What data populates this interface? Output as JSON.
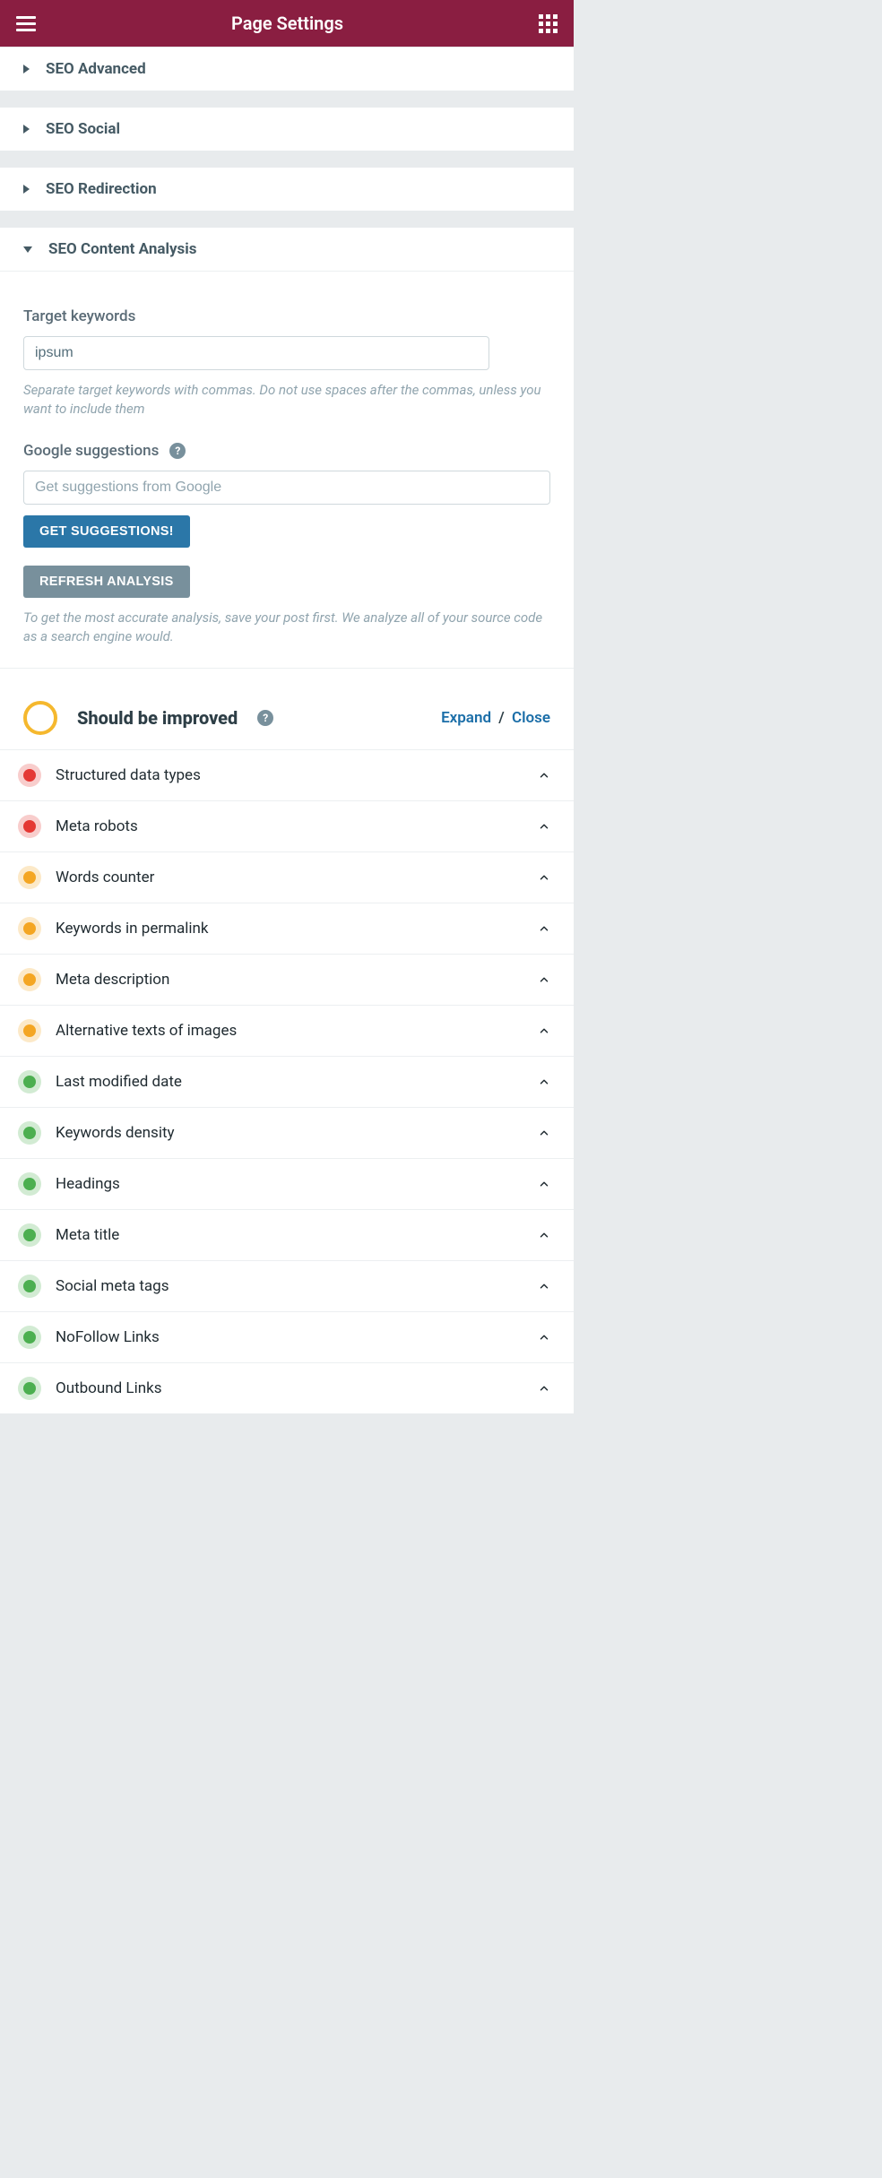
{
  "header": {
    "title": "Page Settings"
  },
  "sections": {
    "seo_advanced": "SEO Advanced",
    "seo_social": "SEO Social",
    "seo_redirection": "SEO Redirection",
    "seo_content_analysis": "SEO Content Analysis"
  },
  "target_keywords": {
    "label": "Target keywords",
    "value": "ipsum",
    "hint": "Separate target keywords with commas. Do not use spaces after the commas, unless you want to include them"
  },
  "google_suggestions": {
    "label": "Google suggestions",
    "placeholder": "Get suggestions from Google",
    "button": "GET SUGGESTIONS!"
  },
  "refresh": {
    "button": "REFRESH ANALYSIS",
    "hint": "To get the most accurate analysis, save your post first. We analyze all of your source code as a search engine would."
  },
  "score": {
    "title": "Should be improved",
    "expand": "Expand",
    "close": "Close"
  },
  "analysis": [
    {
      "label": "Structured data types",
      "status": "red"
    },
    {
      "label": "Meta robots",
      "status": "red"
    },
    {
      "label": "Words counter",
      "status": "orange"
    },
    {
      "label": "Keywords in permalink",
      "status": "orange"
    },
    {
      "label": "Meta description",
      "status": "orange"
    },
    {
      "label": "Alternative texts of images",
      "status": "orange"
    },
    {
      "label": "Last modified date",
      "status": "green"
    },
    {
      "label": "Keywords density",
      "status": "green"
    },
    {
      "label": "Headings",
      "status": "green"
    },
    {
      "label": "Meta title",
      "status": "green"
    },
    {
      "label": "Social meta tags",
      "status": "green"
    },
    {
      "label": "NoFollow Links",
      "status": "green"
    },
    {
      "label": "Outbound Links",
      "status": "green"
    }
  ]
}
